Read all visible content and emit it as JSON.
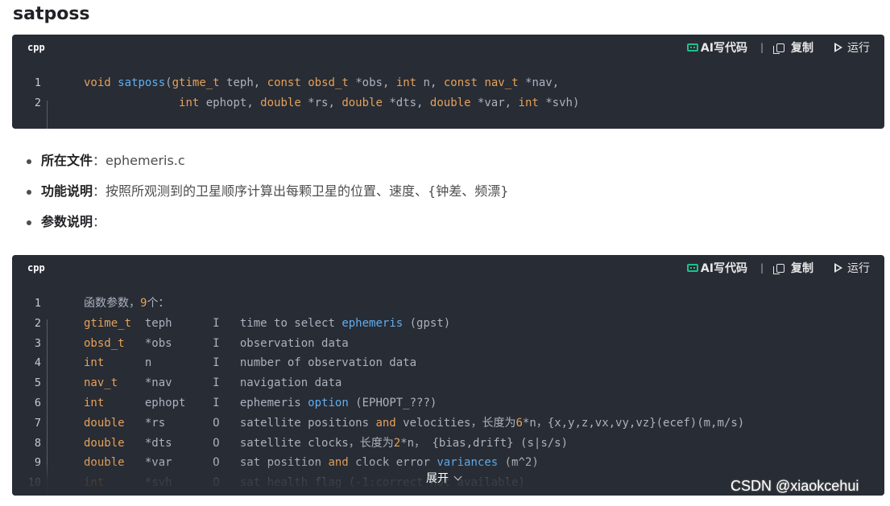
{
  "heading": "satposs",
  "code_block_1": {
    "lang": "cpp",
    "ai_label": "AI写代码",
    "copy_label": "复制",
    "run_label": "运行",
    "lines": [
      "1",
      "2"
    ]
  },
  "bullets": [
    {
      "label": "所在文件",
      "sep": "：",
      "text": "ephemeris.c"
    },
    {
      "label": "功能说明",
      "sep": "：",
      "text": "按照所观测到的卫星顺序计算出每颗卫星的位置、速度、{钟差、频漂}"
    },
    {
      "label": "参数说明",
      "sep": "：",
      "text": ""
    }
  ],
  "code_block_2": {
    "lang": "cpp",
    "ai_label": "AI写代码",
    "copy_label": "复制",
    "run_label": "运行",
    "lines": [
      "1",
      "2",
      "3",
      "4",
      "5",
      "6",
      "7",
      "8",
      "9",
      "10"
    ],
    "expand_label": "展开"
  },
  "watermark": "CSDN @xiaokcehui",
  "colors": {
    "code_bg": "#282c34",
    "keyword": "#e5a15b",
    "function": "#61aeee",
    "ai_icon": "#1ec08b"
  },
  "icons": [
    "ai-code-icon",
    "copy-icon",
    "run-icon",
    "chevron-down-icon"
  ]
}
